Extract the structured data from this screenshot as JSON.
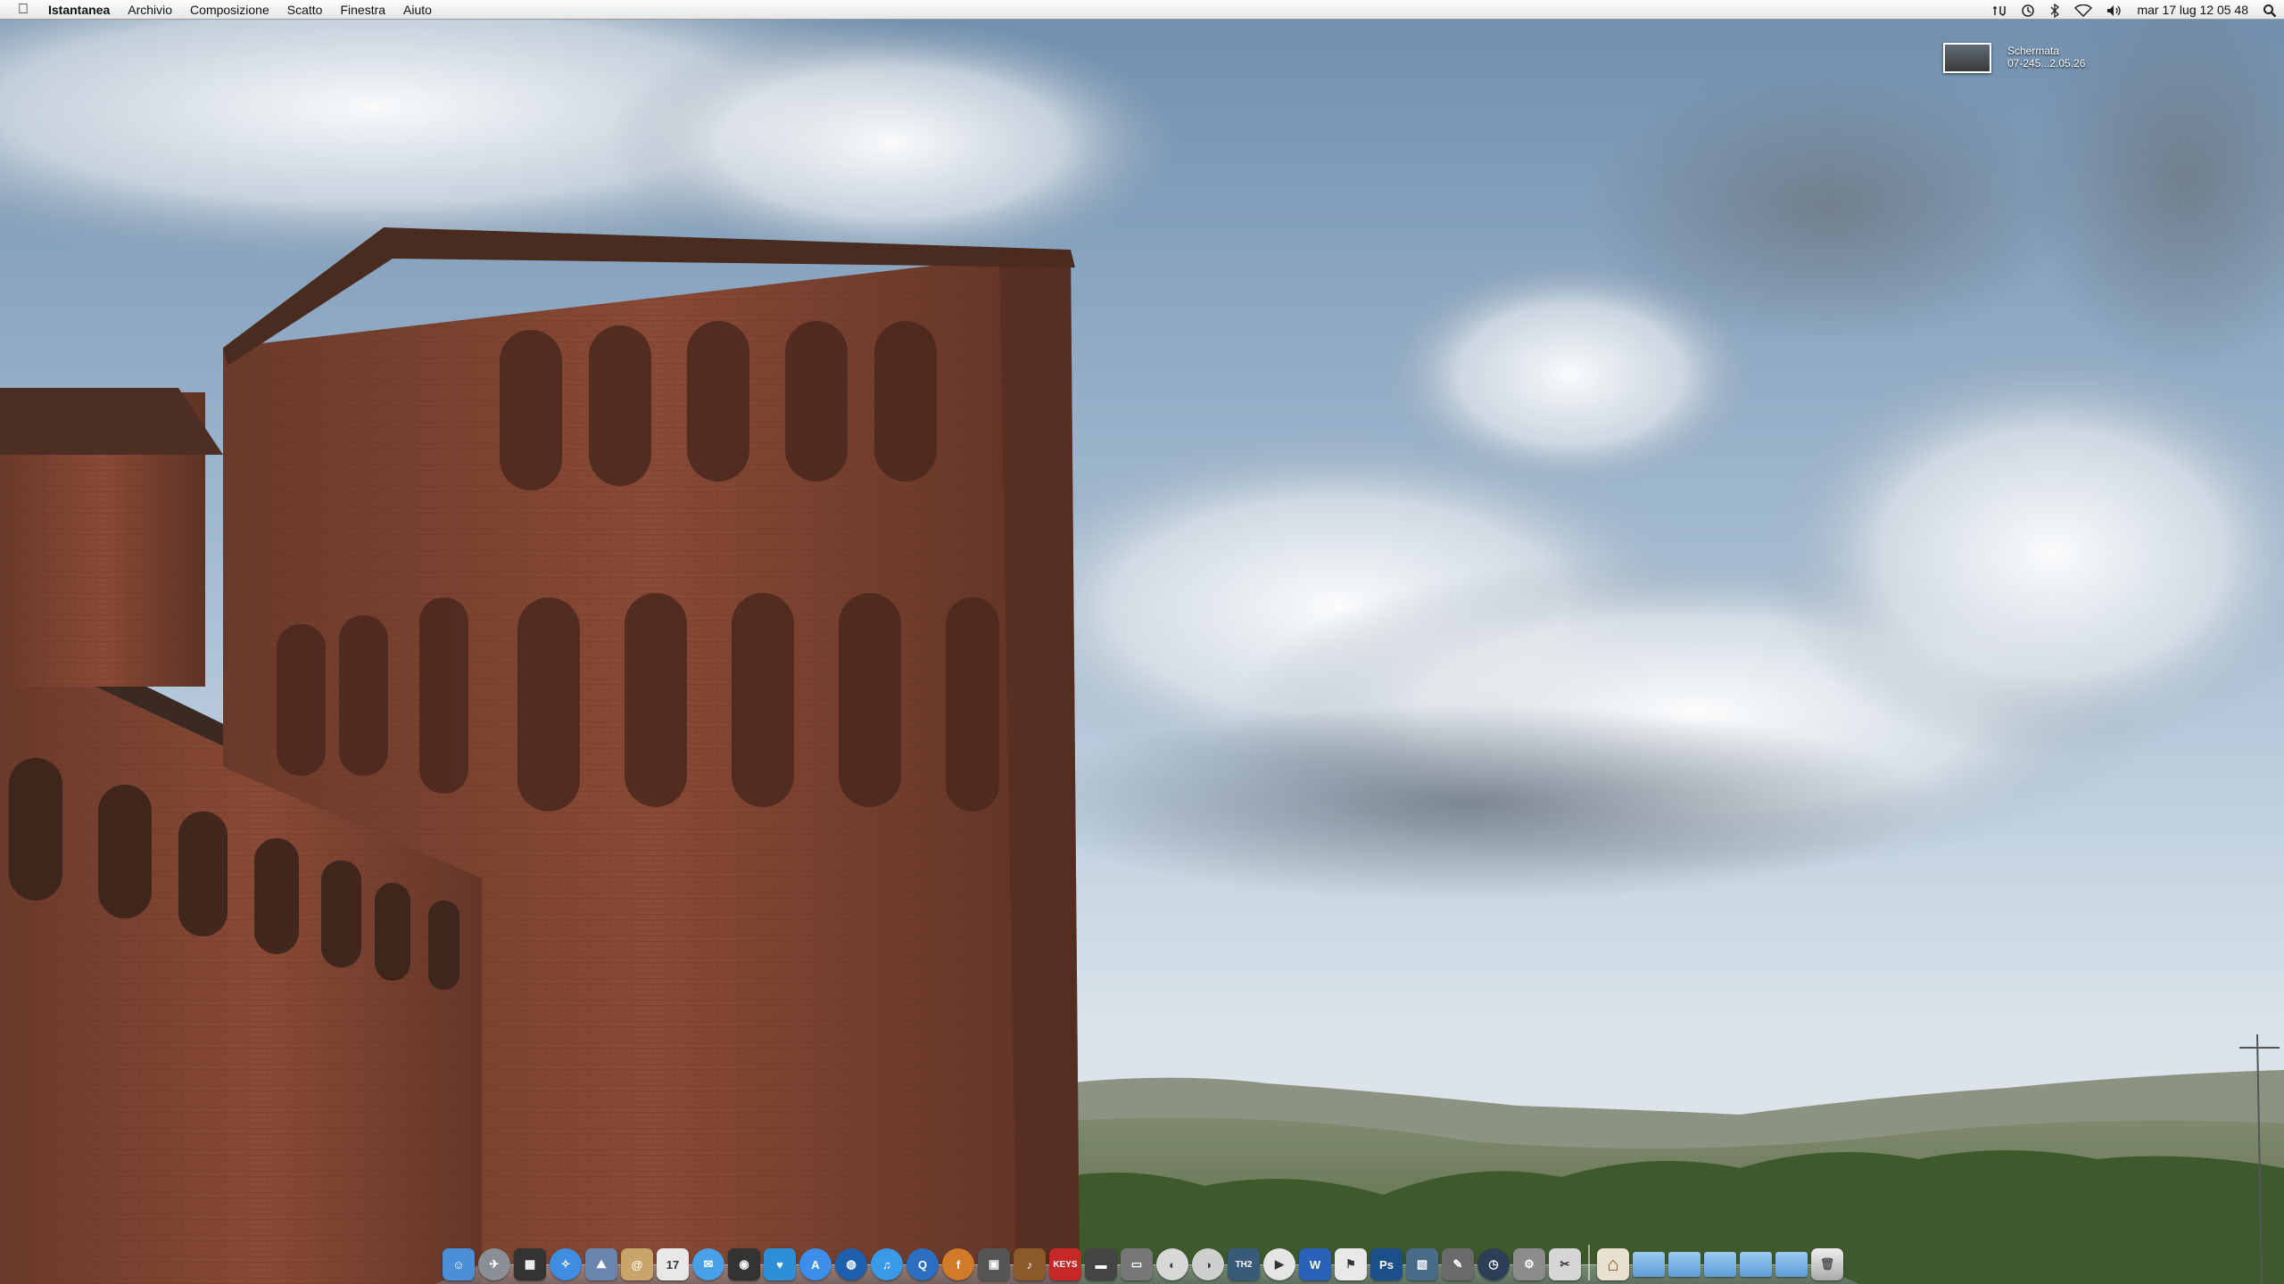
{
  "menubar": {
    "apple_icon": "apple-logo-icon",
    "app_name": "Istantanea",
    "menus": [
      "Archivio",
      "Composizione",
      "Scatto",
      "Finestra",
      "Aiuto"
    ],
    "status_icons": [
      "timemachine-icon",
      "bluetooth-icon",
      "wifi-icon",
      "volume-icon"
    ],
    "clock": "mar 17 lug  12 05 48",
    "search_icon": "spotlight-icon"
  },
  "desktop_file": {
    "line1": "Schermata",
    "line2": "07-245...2.05.26"
  },
  "dock": {
    "apps": [
      {
        "name": "finder",
        "color": "#4a8fd8",
        "glyph": "☺",
        "round": false
      },
      {
        "name": "launchpad",
        "color": "#8a8f96",
        "glyph": "✈",
        "round": true
      },
      {
        "name": "mission-control",
        "color": "#333",
        "glyph": "▦",
        "round": false
      },
      {
        "name": "safari",
        "color": "#3e8de0",
        "glyph": "✧",
        "round": true
      },
      {
        "name": "preview",
        "color": "#6a86b0",
        "glyph": "⛰",
        "round": false
      },
      {
        "name": "contacts",
        "color": "#c8a56a",
        "glyph": "@",
        "round": false
      },
      {
        "name": "calendar",
        "color": "#e8e8e8",
        "glyph": "17",
        "round": false
      },
      {
        "name": "messages",
        "color": "#4aa0e8",
        "glyph": "✉",
        "round": true
      },
      {
        "name": "facetime",
        "color": "#333",
        "glyph": "◉",
        "round": false
      },
      {
        "name": "twitter",
        "color": "#2d8fd5",
        "glyph": "♥",
        "round": false
      },
      {
        "name": "app-store",
        "color": "#3c8ee8",
        "glyph": "A",
        "round": true
      },
      {
        "name": "earth",
        "color": "#1e5fb0",
        "glyph": "◍",
        "round": true
      },
      {
        "name": "itunes",
        "color": "#3a9ae8",
        "glyph": "♫",
        "round": true
      },
      {
        "name": "quicktime",
        "color": "#2a6fc0",
        "glyph": "Q",
        "round": true
      },
      {
        "name": "fetch",
        "color": "#d07a2a",
        "glyph": "f",
        "round": true
      },
      {
        "name": "activity-monitor",
        "color": "#555",
        "glyph": "▣",
        "round": false
      },
      {
        "name": "guitar",
        "color": "#8a5a2a",
        "glyph": "♪",
        "round": false
      },
      {
        "name": "keys",
        "color": "#c62828",
        "glyph": "KEYS",
        "round": false
      },
      {
        "name": "stage",
        "color": "#444",
        "glyph": "▬",
        "round": false
      },
      {
        "name": "cassette",
        "color": "#777",
        "glyph": "▭",
        "round": false
      },
      {
        "name": "transmit",
        "color": "#d8d8d8",
        "glyph": "◐",
        "round": true
      },
      {
        "name": "camino",
        "color": "#cfcfcf",
        "glyph": "◑",
        "round": true
      },
      {
        "name": "th2",
        "color": "#3a5a7a",
        "glyph": "TH2",
        "round": false
      },
      {
        "name": "player",
        "color": "#e5e5e5",
        "glyph": "▶",
        "round": true
      },
      {
        "name": "word",
        "color": "#2a62b8",
        "glyph": "W",
        "round": false
      },
      {
        "name": "acrobat",
        "color": "#e8e8e8",
        "glyph": "⚑",
        "round": false
      },
      {
        "name": "photoshop",
        "color": "#1b4f8a",
        "glyph": "Ps",
        "round": false
      },
      {
        "name": "iphoto",
        "color": "#4a6a8a",
        "glyph": "▧",
        "round": false
      },
      {
        "name": "preview-2",
        "color": "#6a6a6a",
        "glyph": "✎",
        "round": false
      },
      {
        "name": "time-machine",
        "color": "#2d3f56",
        "glyph": "◷",
        "round": true
      },
      {
        "name": "system-preferences",
        "color": "#8c8c8c",
        "glyph": "⚙",
        "round": false
      },
      {
        "name": "screenshot-tool",
        "color": "#d6d6d6",
        "glyph": "✂",
        "round": false
      }
    ],
    "folders": [
      "home",
      "applications",
      "documents",
      "downloads",
      "music",
      "stack"
    ],
    "trash": "trash-icon"
  }
}
